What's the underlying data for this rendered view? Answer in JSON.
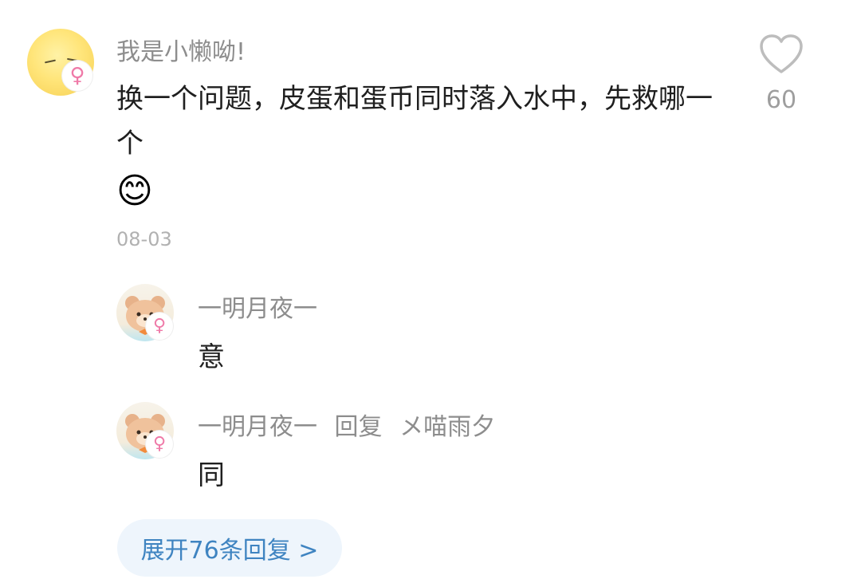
{
  "comment": {
    "author": "我是小懒呦!",
    "text": "换一个问题，皮蛋和蛋币同时落入水中，先救哪一个",
    "emoji": "😊",
    "date": "08-03",
    "like_count": "60",
    "like_icon": "heart-outline-icon",
    "gender_icon": "female-icon"
  },
  "replies": [
    {
      "author": "一明月夜一",
      "reply_to_label": "",
      "reply_to": "",
      "text": "意"
    },
    {
      "author": "一明月夜一",
      "reply_to_label": "回复",
      "reply_to": "メ喵雨夕",
      "text": "同"
    }
  ],
  "expand": {
    "label": "展开76条回复 >"
  },
  "colors": {
    "accent": "#3f84c1",
    "female": "#ef7aa8",
    "name": "#8d8d8d"
  }
}
